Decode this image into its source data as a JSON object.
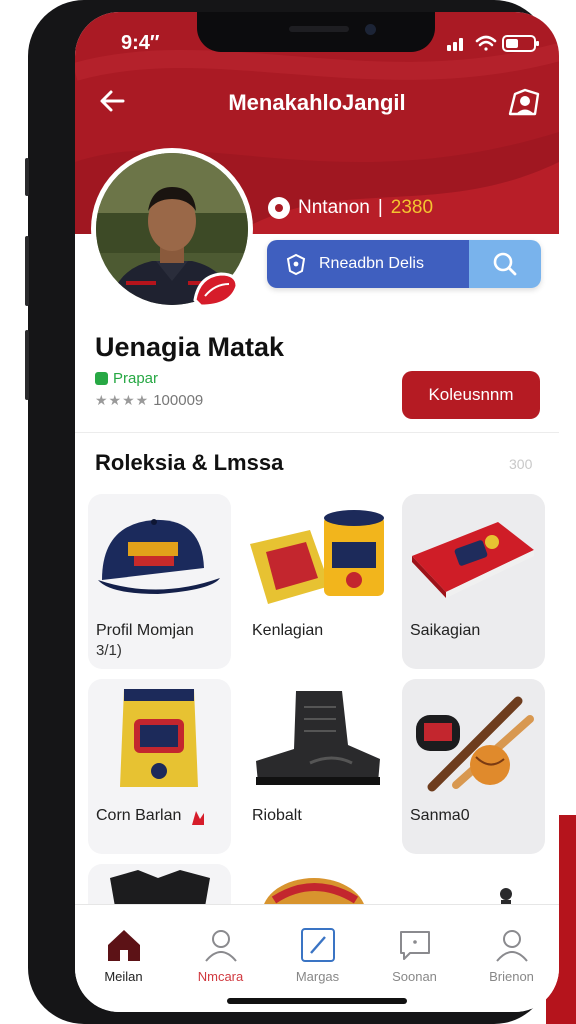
{
  "status_bar": {
    "time": "9:4″"
  },
  "header": {
    "title": "MenakahloJangil"
  },
  "profile": {
    "stat_label": "Nntanon",
    "stat_separator": "|",
    "stat_value": "2380",
    "search_label": "Rneadbn Delis",
    "name": "Uenagia Matak",
    "status": "Prapar",
    "rating_stars": "★★★★",
    "rating_count": "100009",
    "cta_label": "Koleusnnm"
  },
  "section": {
    "title": "Roleksia & Lmssa",
    "count": "300"
  },
  "items": [
    {
      "label": "Profil Momjan",
      "sub": "3/1)"
    },
    {
      "label": "Kenlagian"
    },
    {
      "label": "Saikagian"
    },
    {
      "label": "Corn Barlan"
    },
    {
      "label": "Riobalt"
    },
    {
      "label": "Sanma0"
    }
  ],
  "nav": [
    {
      "label": "Meilan",
      "active": true
    },
    {
      "label": "Nmcara",
      "accent": true
    },
    {
      "label": "Margas"
    },
    {
      "label": "Soonan"
    },
    {
      "label": "Brienon"
    }
  ],
  "colors": {
    "brand_red": "#aa1a24",
    "accent_blue": "#3f5fbf",
    "light_blue": "#79b3ec",
    "online_green": "#27a844",
    "highlight_gold": "#f4c430"
  },
  "icons": [
    "back-arrow-icon",
    "profile-flag-icon",
    "stat-circle-icon",
    "search-icon",
    "home-icon",
    "user-icon",
    "edit-icon",
    "message-icon",
    "account-icon"
  ]
}
